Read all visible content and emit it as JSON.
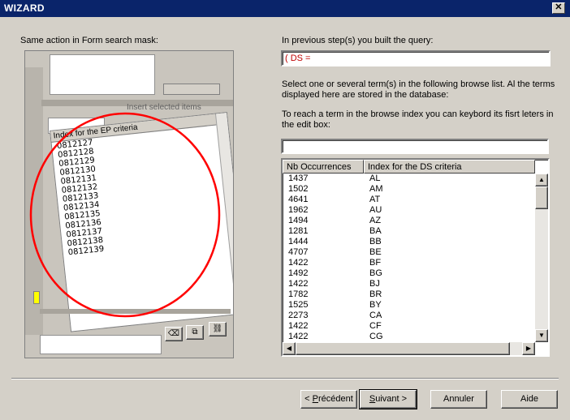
{
  "window": {
    "title": "WIZARD",
    "close": "✕"
  },
  "left": {
    "caption": "Same action in Form search mask:",
    "illustration": {
      "insert_label": "Insert selected items",
      "list_header": "Index for the EP criteria",
      "items": [
        "0812127",
        "0812128",
        "0812129",
        "0812130",
        "0812131",
        "0812132",
        "0812133",
        "0812134",
        "0812135",
        "0812136",
        "0812137",
        "0812138",
        "0812139"
      ],
      "highlight_color": "#ff0000"
    }
  },
  "right": {
    "query_label": "In previous step(s) you built the query:",
    "query_value": "( DS =",
    "info_text_1": "Select one or several term(s) in the following browse list. Al the terms displayed here are stored in the database:",
    "info_text_2": "To reach a term in the browse index you can keybord its fisrt leters in the edit box:",
    "edit_value": "",
    "list": {
      "col1": "Nb Occurrences",
      "col2": "Index for the DS criteria",
      "rows": [
        {
          "count": "1437",
          "term": "AL"
        },
        {
          "count": "1502",
          "term": "AM"
        },
        {
          "count": "4641",
          "term": "AT"
        },
        {
          "count": "1962",
          "term": "AU"
        },
        {
          "count": "1494",
          "term": "AZ"
        },
        {
          "count": "1281",
          "term": "BA"
        },
        {
          "count": "1444",
          "term": "BB"
        },
        {
          "count": "4707",
          "term": "BE"
        },
        {
          "count": "1422",
          "term": "BF"
        },
        {
          "count": "1492",
          "term": "BG"
        },
        {
          "count": "1422",
          "term": "BJ"
        },
        {
          "count": "1782",
          "term": "BR"
        },
        {
          "count": "1525",
          "term": "BY"
        },
        {
          "count": "2273",
          "term": "CA"
        },
        {
          "count": "1422",
          "term": "CF"
        },
        {
          "count": "1422",
          "term": "CG"
        }
      ]
    }
  },
  "buttons": {
    "prev_prefix": "< ",
    "prev_accel": "P",
    "prev_rest": "récédent",
    "next_accel": "S",
    "next_rest": "uivant >",
    "cancel": "Annuler",
    "help": "Aide"
  }
}
